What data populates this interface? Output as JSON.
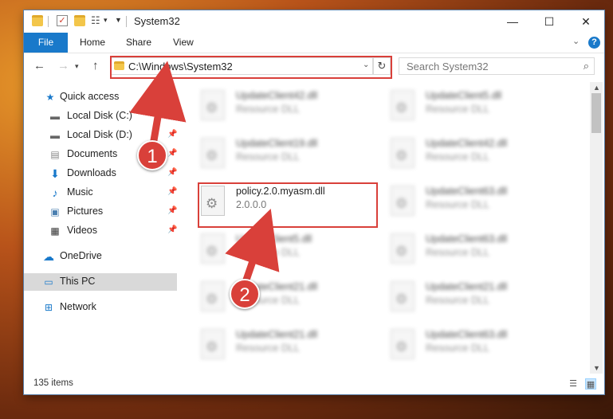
{
  "window": {
    "title": "System32",
    "controls": {
      "minimize": "—",
      "maximize": "☐",
      "close": "✕"
    }
  },
  "ribbon": {
    "tabs": [
      "File",
      "Home",
      "Share",
      "View"
    ],
    "help": "?"
  },
  "address": {
    "path": "C:\\Windows\\System32",
    "search_placeholder": "Search System32"
  },
  "sidebar": {
    "items": [
      {
        "label": "Quick access",
        "icon": "star-icon",
        "pinned": false
      },
      {
        "label": "Local Disk (C:)",
        "icon": "drive-icon",
        "pinned": true
      },
      {
        "label": "Local Disk (D:)",
        "icon": "drive-icon",
        "pinned": true
      },
      {
        "label": "Documents",
        "icon": "documents-icon",
        "pinned": true
      },
      {
        "label": "Downloads",
        "icon": "downloads-icon",
        "pinned": true
      },
      {
        "label": "Music",
        "icon": "music-icon",
        "pinned": true
      },
      {
        "label": "Pictures",
        "icon": "pictures-icon",
        "pinned": true
      },
      {
        "label": "Videos",
        "icon": "videos-icon",
        "pinned": true
      },
      {
        "label": "OneDrive",
        "icon": "onedrive-icon",
        "pinned": false
      },
      {
        "label": "This PC",
        "icon": "computer-icon",
        "pinned": false,
        "selected": true
      },
      {
        "label": "Network",
        "icon": "network-icon",
        "pinned": false
      }
    ]
  },
  "files": {
    "left": [
      {
        "name": "UpdateClient42.dll",
        "desc": "Resource DLL"
      },
      {
        "name": "UpdateClient19.dll",
        "desc": "Resource DLL"
      },
      {
        "name": "policy.2.0.myasm.dll",
        "desc": "2.0.0.0"
      },
      {
        "name": "UpdateClient5.dll",
        "desc": "Resource DLL"
      },
      {
        "name": "UpdateClient21.dll",
        "desc": "Resource DLL"
      },
      {
        "name": "UpdateClient21.dll",
        "desc": "Resource DLL"
      }
    ],
    "right": [
      {
        "name": "UpdateClient5.dll",
        "desc": "Resource DLL"
      },
      {
        "name": "UpdateClient42.dll",
        "desc": "Resource DLL"
      },
      {
        "name": "UpdateClient63.dll",
        "desc": "Resource DLL"
      },
      {
        "name": "UpdateClient63.dll",
        "desc": "Resource DLL"
      },
      {
        "name": "UpdateClient21.dll",
        "desc": "Resource DLL"
      },
      {
        "name": "UpdateClient63.dll",
        "desc": "Resource DLL"
      }
    ]
  },
  "status": {
    "item_count": "135 items"
  },
  "annotations": {
    "step1": "1",
    "step2": "2",
    "color": "#d9403a"
  }
}
